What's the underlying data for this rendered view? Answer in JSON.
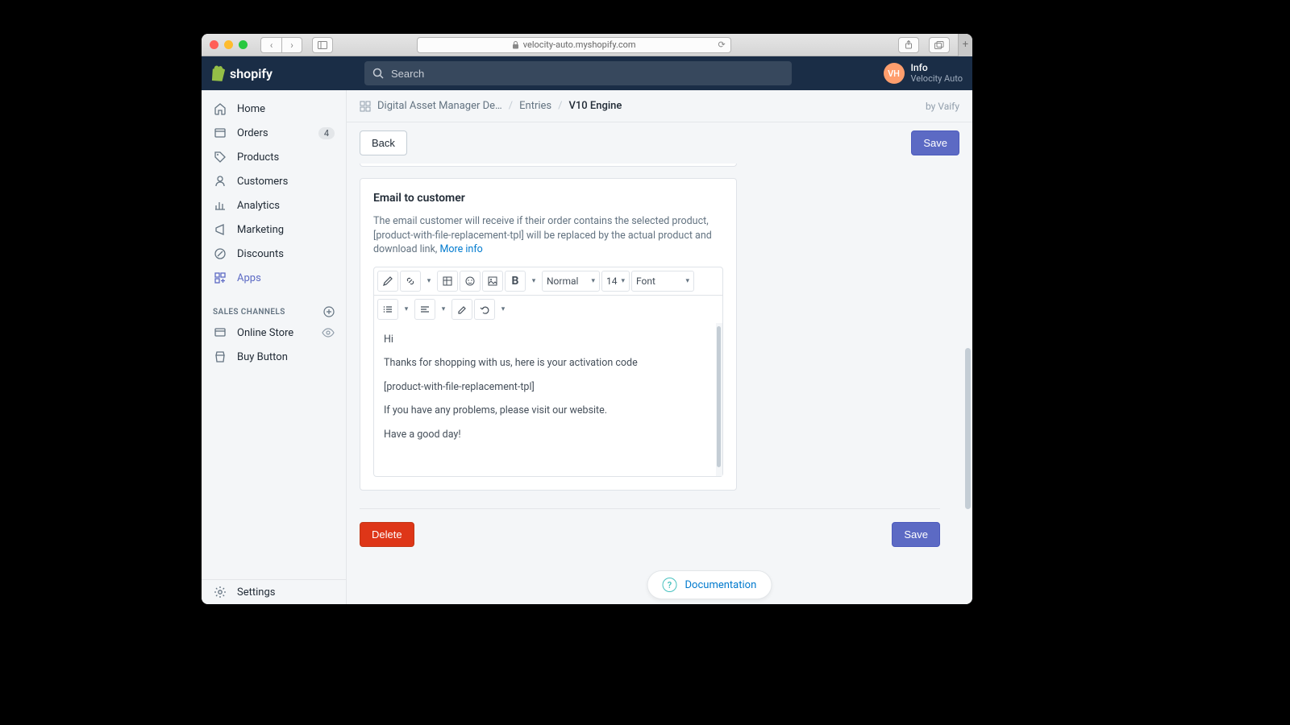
{
  "browser": {
    "url": "velocity-auto.myshopify.com"
  },
  "header": {
    "brand": "shopify",
    "search_placeholder": "Search",
    "user_initials": "VH",
    "user_line1": "Info",
    "user_line2": "Velocity Auto"
  },
  "sidebar": {
    "items": [
      {
        "label": "Home"
      },
      {
        "label": "Orders",
        "badge": "4"
      },
      {
        "label": "Products"
      },
      {
        "label": "Customers"
      },
      {
        "label": "Analytics"
      },
      {
        "label": "Marketing"
      },
      {
        "label": "Discounts"
      },
      {
        "label": "Apps"
      }
    ],
    "channels_heading": "SALES CHANNELS",
    "channels": [
      {
        "label": "Online Store"
      },
      {
        "label": "Buy Button"
      }
    ],
    "settings": "Settings"
  },
  "breadcrumb": {
    "root": "Digital Asset Manager De…",
    "mid": "Entries",
    "current": "V10 Engine",
    "byline": "by Vaify"
  },
  "actions": {
    "back": "Back",
    "save": "Save",
    "delete": "Delete",
    "save_bottom": "Save"
  },
  "card": {
    "title": "Email to customer",
    "desc": "The email customer will receive if their order contains the selected product, [product-with-file-replacement-tpl] will be replaced by the actual product and download link,",
    "more": "More info"
  },
  "toolbar": {
    "format": "Normal",
    "size": "14",
    "font": "Font"
  },
  "email_body": {
    "l1": "Hi",
    "l2": "Thanks for shopping with us, here is your activation code",
    "l3": "[product-with-file-replacement-tpl]",
    "l4": "If you have any problems, please visit our website.",
    "l5": "Have a good day!"
  },
  "doc_label": "Documentation"
}
